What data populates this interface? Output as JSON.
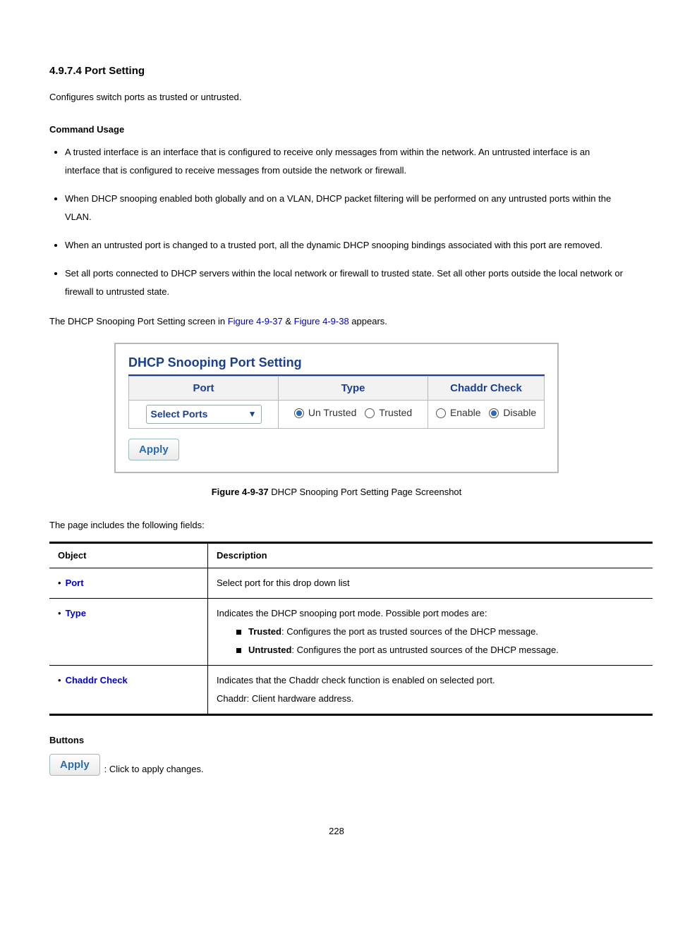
{
  "heading": "4.9.7.4 Port Setting",
  "intro": "Configures switch ports as trusted or untrusted.",
  "command_usage_label": "Command Usage",
  "usage": [
    "A trusted interface is an interface that is configured to receive only messages from within the network. An untrusted interface is an interface that is configured to receive messages from outside the network or firewall.",
    "When DHCP snooping enabled both globally and on a VLAN, DHCP packet filtering will be performed on any untrusted ports within the VLAN.",
    "When an untrusted port is changed to a trusted port, all the dynamic DHCP snooping bindings associated with this port are removed.",
    "Set all ports connected to DHCP servers within the local network or firewall to trusted state. Set all other ports outside the local network or firewall to untrusted state."
  ],
  "screen_line": {
    "pre": "The DHCP Snooping Port Setting screen in ",
    "link1": "Figure 4-9-37",
    "mid": " & ",
    "link2": "Figure 4-9-38",
    "post": " appears."
  },
  "figure": {
    "title": "DHCP Snooping Port Setting",
    "cols": {
      "port": "Port",
      "type": "Type",
      "chaddr": "Chaddr Check"
    },
    "port_select": "Select Ports",
    "type_opts": {
      "untrusted": "Un Trusted",
      "trusted": "Trusted"
    },
    "chaddr_opts": {
      "enable": "Enable",
      "disable": "Disable"
    },
    "apply": "Apply"
  },
  "caption": {
    "b": "Figure 4-9-37",
    "rest": " DHCP Snooping Port Setting Page Screenshot"
  },
  "fields_intro": "The page includes the following fields:",
  "fields_head": {
    "obj": "Object",
    "desc": "Description"
  },
  "fields": {
    "port": {
      "name": "Port",
      "desc": "Select port for this drop down list"
    },
    "type": {
      "name": "Type",
      "lead": "Indicates the DHCP snooping port mode. Possible port modes are:",
      "trusted_b": "Trusted",
      "trusted_rest": ": Configures the port as trusted sources of the DHCP message.",
      "untrusted_b": "Untrusted",
      "untrusted_rest": ": Configures the port as untrusted sources of the DHCP message."
    },
    "chaddr": {
      "name": "Chaddr Check",
      "line1": "Indicates that the Chaddr check function is enabled on selected port.",
      "line2": "Chaddr: Client hardware address."
    }
  },
  "buttons_label": "Buttons",
  "apply_btn": "Apply",
  "apply_desc": ": Click to apply changes.",
  "page_number": "228"
}
